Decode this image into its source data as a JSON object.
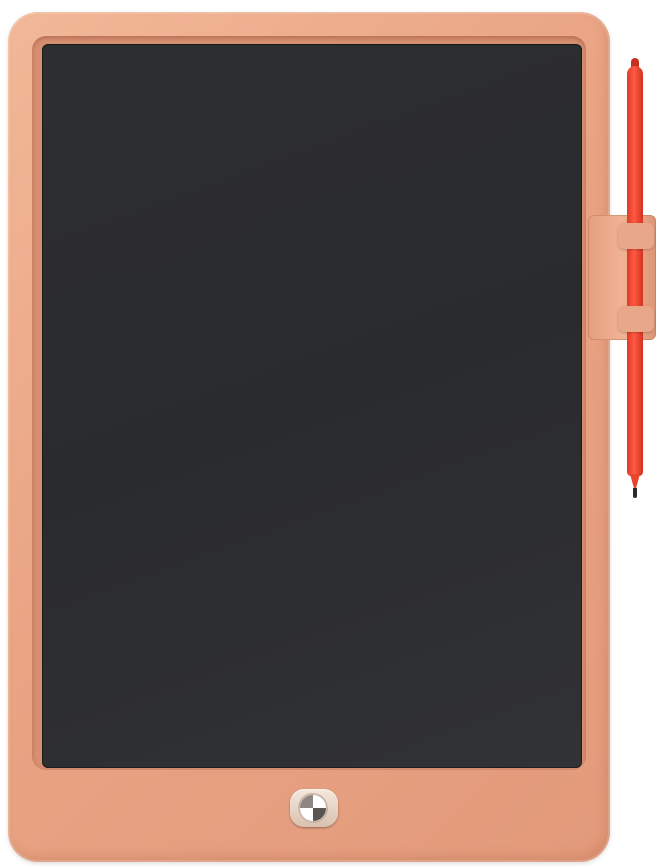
{
  "product": {
    "name": "",
    "colors": {
      "frame": "#e9a484",
      "screen": "#2d2e30",
      "stylus": "#ff4a36",
      "erase_button": "#f6e8dc"
    }
  },
  "controls": {
    "erase_button_icon": "lock-dial-icon"
  }
}
